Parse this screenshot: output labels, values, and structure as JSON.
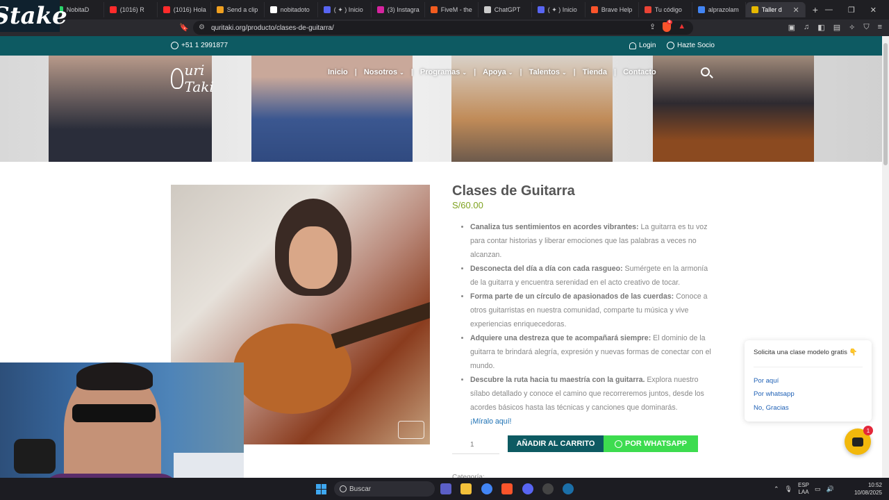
{
  "browser": {
    "tabs": [
      {
        "label": "NobitaD",
        "color": "#2bd36b"
      },
      {
        "label": "(1016) R",
        "color": "#ff2b2b"
      },
      {
        "label": "(1016) Hola",
        "color": "#ff2b2b"
      },
      {
        "label": "Send a clip",
        "color": "#f0a020"
      },
      {
        "label": "nobitadoto",
        "color": "#ffffff"
      },
      {
        "label": "( ✦ ) Inicio",
        "color": "#5865f2"
      },
      {
        "label": "(3) Instagra",
        "color": "#d6249f"
      },
      {
        "label": "FiveM - the",
        "color": "#f25c1f"
      },
      {
        "label": "ChatGPT",
        "color": "#cccccc"
      },
      {
        "label": "( ✦ ) Inicio",
        "color": "#5865f2"
      },
      {
        "label": "Brave Help",
        "color": "#fb542b"
      },
      {
        "label": "Tu código",
        "color": "#ea4335"
      },
      {
        "label": "alprazolam",
        "color": "#4285f4"
      },
      {
        "label": "Taller d",
        "color": "#e6b800"
      }
    ],
    "address": "quritaki.org/producto/clases-de-guitarra/",
    "shield_count": "6"
  },
  "stake_logo": "Stake",
  "site": {
    "phone": "+51 1 2991877",
    "login": "Login",
    "socio": "Hazte Socio",
    "logo_text": "uri Taki",
    "nav": {
      "inicio": "Inicio",
      "nosotros": "Nosotros",
      "programas": "Programas",
      "apoya": "Apoya",
      "talentos": "Talentos",
      "tienda": "Tienda",
      "contacto": "Contacto"
    }
  },
  "product": {
    "title": "Clases de Guitarra",
    "price": "S/60.00",
    "features": [
      {
        "bold": "Canaliza tus sentimientos en acordes vibrantes:",
        "text": " La guitarra es tu voz para contar historias y liberar emociones que las palabras a veces no alcanzan."
      },
      {
        "bold": "Desconecta del día a día con cada rasgueo:",
        "text": " Sumérgete en la armonía de la guitarra y encuentra serenidad en el acto creativo de tocar."
      },
      {
        "bold": "Forma parte de un círculo de apasionados de las cuerdas:",
        "text": " Conoce a otros guitarristas en nuestra comunidad, comparte tu música y vive experiencias enriquecedoras."
      },
      {
        "bold": "Adquiere una destreza que te acompañará siempre:",
        "text": " El dominio de la guitarra te brindará alegría, expresión y nuevas formas de conectar con el mundo."
      },
      {
        "bold": "Descubre la ruta hacia tu maestría con la guitarra.",
        "text": " Explora nuestro sílabo detallado y conoce el camino que recorreremos juntos, desde los acordes básicos hasta las técnicas y canciones que dominarás."
      }
    ],
    "more_link": "¡Míralo aquí!",
    "quantity": "1",
    "add_to_cart": "AÑADIR AL CARRITO",
    "whatsapp": "POR WHATSAPP",
    "category_label": "Categoría:"
  },
  "popup": {
    "question": "Solicita una clase modelo gratis 👇",
    "options": [
      "Por aquí",
      "Por whatsapp",
      "No, Gracias"
    ],
    "badge": "1"
  },
  "taskbar": {
    "search": "Buscar",
    "lang_top": "ESP",
    "lang_bottom": "LAA",
    "time": "10:52",
    "date": "10/08/2025"
  }
}
